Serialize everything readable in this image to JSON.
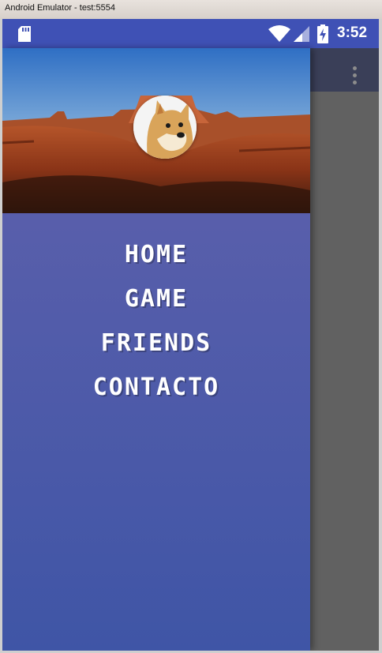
{
  "window": {
    "title": "Android Emulator - test:5554"
  },
  "status_bar": {
    "time": "3:52",
    "icons": [
      "sd-card-icon",
      "wifi-icon",
      "cell-signal-icon",
      "battery-charging-icon"
    ],
    "color": "#3f51b5"
  },
  "toolbar": {
    "overflow_icon": "more-vert-icon"
  },
  "drawer": {
    "header": {
      "background": "desert-landscape",
      "avatar": "doge-avatar"
    },
    "menu": [
      {
        "label": "HOME"
      },
      {
        "label": "GAME"
      },
      {
        "label": "FRIENDS"
      },
      {
        "label": "CONTACTO"
      }
    ],
    "gradient": [
      "#6262ad",
      "#3f55a6"
    ]
  }
}
